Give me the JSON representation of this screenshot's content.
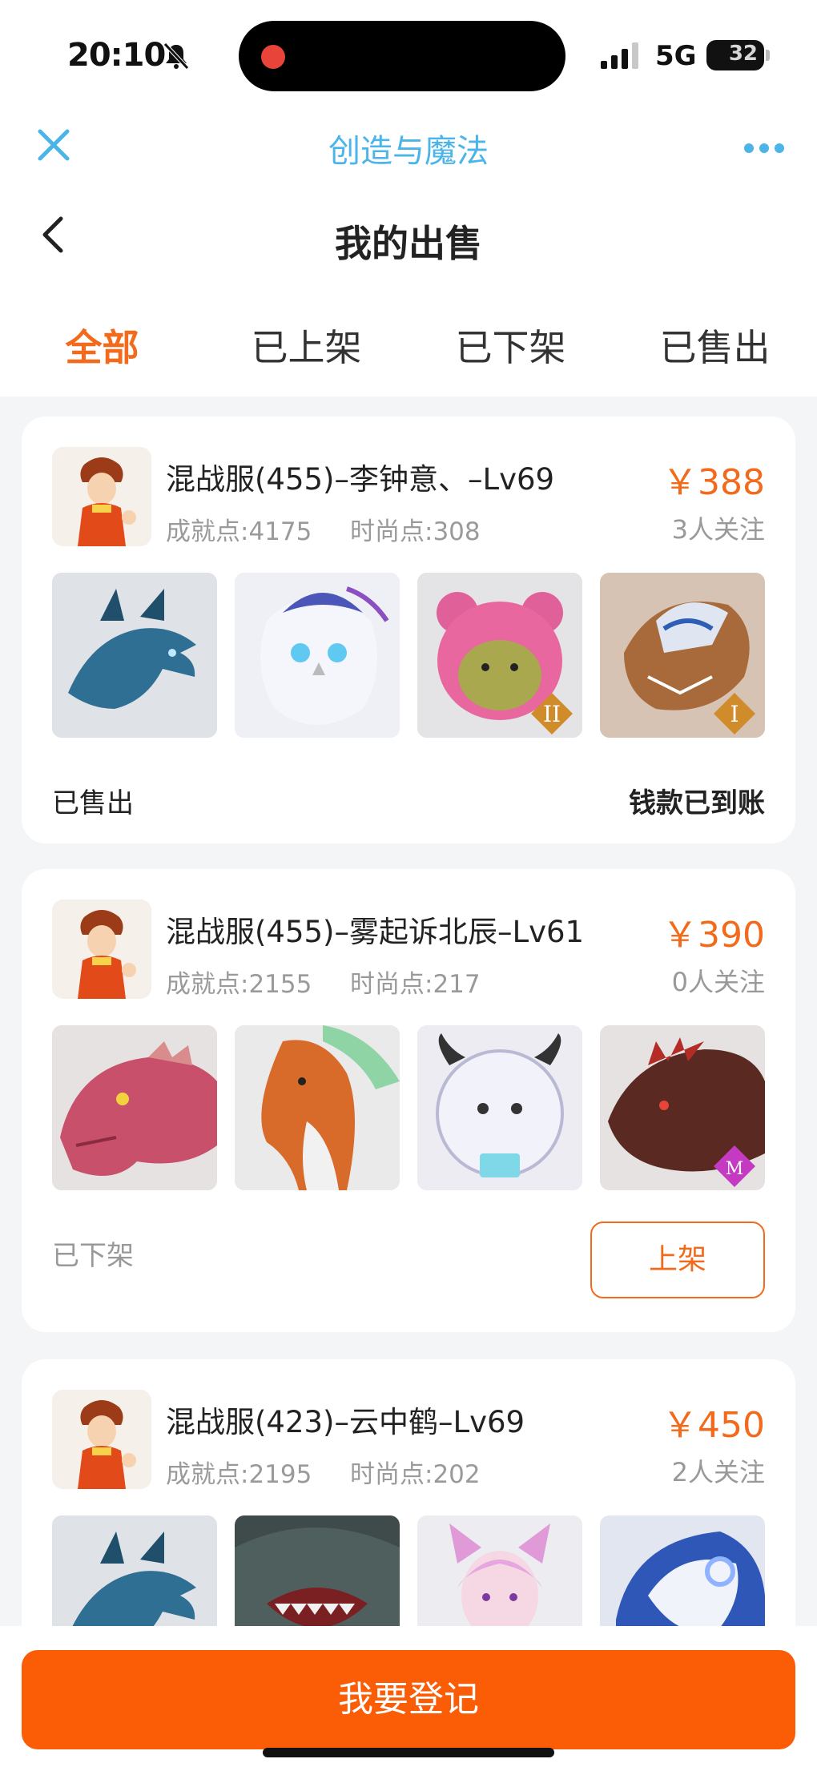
{
  "status_bar": {
    "time": "20:10",
    "network": "5G",
    "battery": "32"
  },
  "app_bar": {
    "title": "创造与魔法"
  },
  "header": {
    "title": "我的出售"
  },
  "tabs": [
    {
      "label": "全部",
      "active": true
    },
    {
      "label": "已上架",
      "active": false
    },
    {
      "label": "已下架",
      "active": false
    },
    {
      "label": "已售出",
      "active": false
    }
  ],
  "listings": [
    {
      "title": "混战服(455)–李钟意、–Lv69",
      "achievement": "成就点:4175",
      "fashion": "时尚点:308",
      "price": "￥388",
      "watchers": "3人关注",
      "status": "已售出",
      "note": "钱款已到账",
      "thumbs": [
        "blue-dragon",
        "white-owl",
        "pink-bear",
        "armored-wolf"
      ]
    },
    {
      "title": "混战服(455)–雾起诉北辰–Lv61",
      "achievement": "成就点:2155",
      "fashion": "时尚点:217",
      "price": "￥390",
      "watchers": "0人关注",
      "status": "已下架",
      "action": "上架",
      "thumbs": [
        "red-dragon",
        "orange-horse",
        "white-cow",
        "dark-beast"
      ]
    },
    {
      "title": "混战服(423)–云中鹤–Lv69",
      "achievement": "成就点:2195",
      "fashion": "时尚点:202",
      "price": "￥450",
      "watchers": "2人关注",
      "thumbs": [
        "blue-dragon",
        "shark",
        "fox-girl",
        "ice-tiger"
      ]
    }
  ],
  "footer": {
    "button": "我要登记"
  },
  "colors": {
    "accent": "#f26a1b",
    "button": "#fb5c06",
    "title_blue": "#4bb4e8"
  }
}
